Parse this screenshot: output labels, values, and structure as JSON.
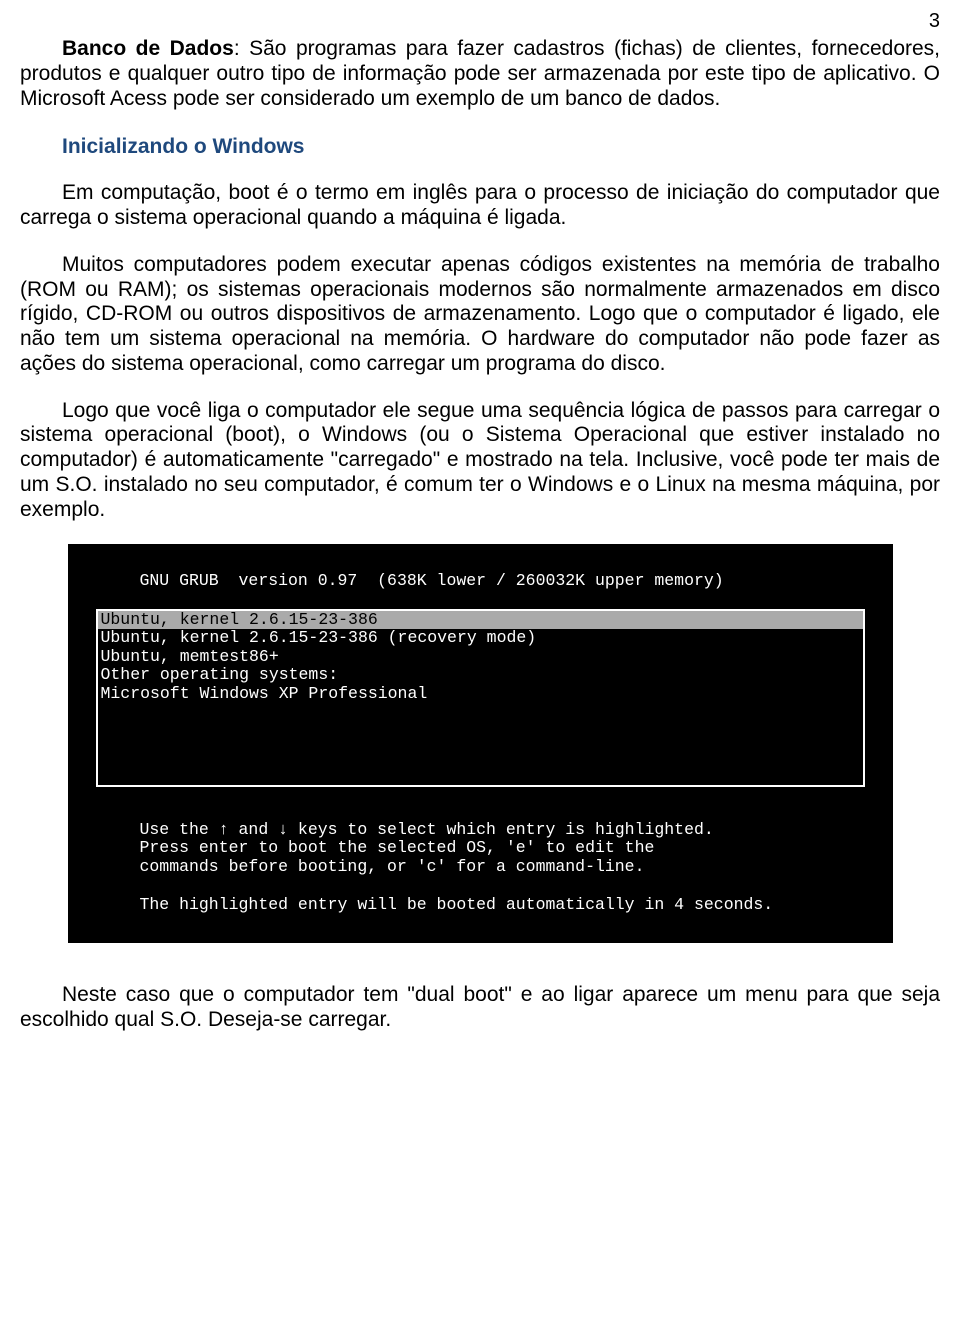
{
  "page_number": "3",
  "paragraphs": {
    "p1_bold": "Banco de Dados",
    "p1_rest": ": São programas para fazer cadastros (fichas) de clientes, fornecedores, produtos e qualquer outro tipo de informação pode ser armazenada por este tipo de aplicativo. O Microsoft Acess pode ser considerado um exemplo de um banco de dados.",
    "heading": "Inicializando o Windows",
    "p2": "Em computação, boot é o termo em inglês para o processo de iniciação do computador que carrega o sistema operacional quando a máquina é ligada.",
    "p3": "Muitos computadores podem executar apenas códigos existentes na memória de trabalho (ROM ou RAM); os sistemas operacionais modernos são normalmente armazenados em disco rígido, CD-ROM ou outros dispositivos de armazenamento. Logo que o computador é ligado, ele não tem um sistema operacional na memória. O hardware do computador não pode fazer as ações do sistema operacional, como carregar um programa do disco.",
    "p4": "Logo que você liga o computador ele segue uma sequência lógica de passos para carregar o sistema operacional (boot), o Windows (ou o Sistema Operacional que estiver instalado no computador) é automaticamente \"carregado\" e mostrado na tela. Inclusive, você pode ter mais de um S.O. instalado no seu computador, é comum ter o Windows e o Linux na mesma máquina, por exemplo.",
    "p5": "Neste caso que o computador tem \"dual boot\" e ao ligar aparece um menu para que seja escolhido qual S.O. Deseja-se carregar."
  },
  "grub": {
    "header": "GNU GRUB  version 0.97  (638K lower / 260032K upper memory)",
    "menu": [
      {
        "label": "Ubuntu, kernel 2.6.15-23-386",
        "selected": true
      },
      {
        "label": "Ubuntu, kernel 2.6.15-23-386 (recovery mode)",
        "selected": false
      },
      {
        "label": "Ubuntu, memtest86+",
        "selected": false
      },
      {
        "label": "Other operating systems:",
        "selected": false
      },
      {
        "label": "Microsoft Windows XP Professional",
        "selected": false
      }
    ],
    "instructions_l1": "Use the ↑ and ↓ keys to select which entry is highlighted.",
    "instructions_l2": "Press enter to boot the selected OS, 'e' to edit the",
    "instructions_l3": "commands before booting, or 'c' for a command-line.",
    "footer": "The highlighted entry will be booted automatically in 4 seconds."
  }
}
